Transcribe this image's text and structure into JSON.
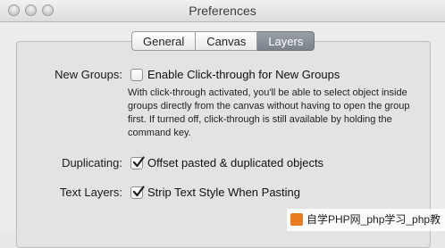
{
  "window": {
    "title": "Preferences"
  },
  "tabs": [
    {
      "label": "General",
      "active": false
    },
    {
      "label": "Canvas",
      "active": false
    },
    {
      "label": "Layers",
      "active": true
    }
  ],
  "new_groups": {
    "label": "New Groups:",
    "checkbox_label": "Enable Click-through for New Groups",
    "checked": false,
    "description": "With click-through activated, you'll be able to select object inside groups directly from the canvas without having to open the group first. If turned off, click-through is still available by holding the command key."
  },
  "duplicating": {
    "label": "Duplicating:",
    "checkbox_label": "Offset pasted & duplicated objects",
    "checked": true
  },
  "text_layers": {
    "label": "Text Layers:",
    "checkbox_label": "Strip Text Style When Pasting",
    "checked": true
  },
  "watermark": {
    "text": "自学PHP网_php学习_php教"
  },
  "colors": {
    "active_tab": "#7b828b",
    "checkmark": "#1f1f1f"
  }
}
